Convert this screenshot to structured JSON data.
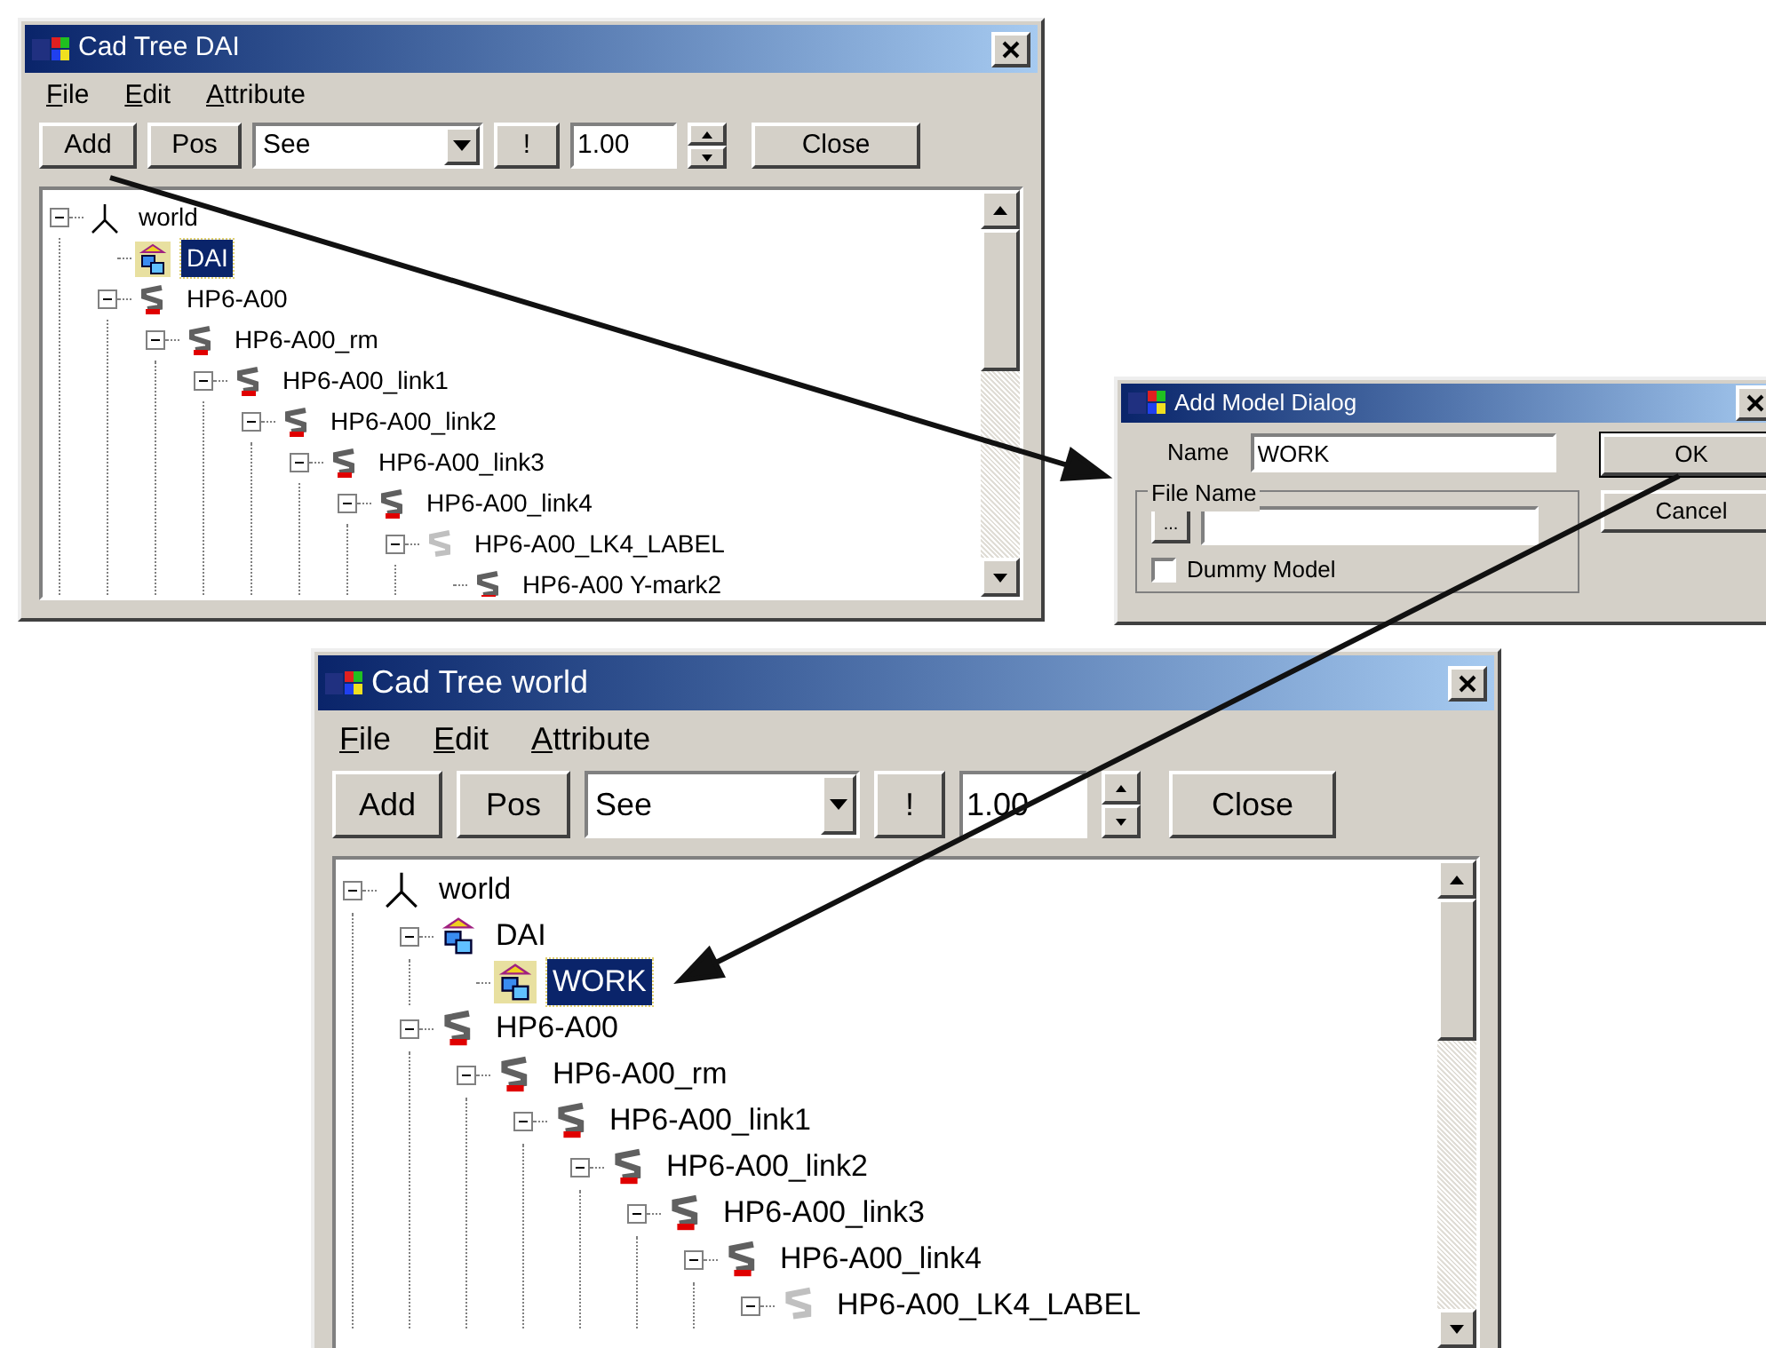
{
  "windows": [
    {
      "title": "Cad Tree DAI",
      "menu": [
        "File",
        "Edit",
        "Attribute"
      ],
      "toolbar": {
        "add": "Add",
        "pos": "Pos",
        "combo": "See",
        "bang": "!",
        "scale": "1.00",
        "close": "Close"
      },
      "tree": [
        {
          "label": "world",
          "kind": "axes",
          "selected": false,
          "expanded": true,
          "children": [
            {
              "label": "DAI",
              "kind": "model",
              "selected": true
            },
            {
              "label": "HP6-A00",
              "kind": "robot",
              "selected": false,
              "expanded": true,
              "children": [
                {
                  "label": "HP6-A00_rm",
                  "kind": "robot",
                  "selected": false,
                  "expanded": true,
                  "children": [
                    {
                      "label": "HP6-A00_link1",
                      "kind": "robot",
                      "selected": false,
                      "expanded": true,
                      "children": [
                        {
                          "label": "HP6-A00_link2",
                          "kind": "robot",
                          "selected": false,
                          "expanded": true,
                          "children": [
                            {
                              "label": "HP6-A00_link3",
                              "kind": "robot",
                              "selected": false,
                              "expanded": true,
                              "children": [
                                {
                                  "label": "HP6-A00_link4",
                                  "kind": "robot",
                                  "selected": false,
                                  "expanded": true,
                                  "children": [
                                    {
                                      "label": "HP6-A00_LK4_LABEL",
                                      "kind": "label",
                                      "selected": false,
                                      "expanded": true,
                                      "children": [
                                        {
                                          "label": "HP6-A00 Y-mark2",
                                          "kind": "robot",
                                          "selected": false
                                        }
                                      ]
                                    }
                                  ]
                                }
                              ]
                            }
                          ]
                        }
                      ]
                    }
                  ]
                }
              ]
            }
          ]
        }
      ]
    },
    {
      "title": "Cad Tree world",
      "menu": [
        "File",
        "Edit",
        "Attribute"
      ],
      "toolbar": {
        "add": "Add",
        "pos": "Pos",
        "combo": "See",
        "bang": "!",
        "scale": "1.00",
        "close": "Close"
      },
      "tree": [
        {
          "label": "world",
          "kind": "axes",
          "selected": false,
          "expanded": true,
          "children": [
            {
              "label": "DAI",
              "kind": "model",
              "selected": false,
              "expanded": true,
              "children": [
                {
                  "label": "WORK",
                  "kind": "model",
                  "selected": true
                }
              ]
            },
            {
              "label": "HP6-A00",
              "kind": "robot",
              "selected": false,
              "expanded": true,
              "children": [
                {
                  "label": "HP6-A00_rm",
                  "kind": "robot",
                  "selected": false,
                  "expanded": true,
                  "children": [
                    {
                      "label": "HP6-A00_link1",
                      "kind": "robot",
                      "selected": false,
                      "expanded": true,
                      "children": [
                        {
                          "label": "HP6-A00_link2",
                          "kind": "robot",
                          "selected": false,
                          "expanded": true,
                          "children": [
                            {
                              "label": "HP6-A00_link3",
                              "kind": "robot",
                              "selected": false,
                              "expanded": true,
                              "children": [
                                {
                                  "label": "HP6-A00_link4",
                                  "kind": "robot",
                                  "selected": false,
                                  "expanded": true,
                                  "children": [
                                    {
                                      "label": "HP6-A00_LK4_LABEL",
                                      "kind": "label",
                                      "selected": false,
                                      "expanded": true
                                    }
                                  ]
                                }
                              ]
                            }
                          ]
                        }
                      ]
                    }
                  ]
                }
              ]
            }
          ]
        }
      ]
    }
  ],
  "dialog": {
    "title": "Add Model Dialog",
    "name_label": "Name",
    "name_value": "WORK",
    "ok": "OK",
    "cancel": "Cancel",
    "file_group": "File Name",
    "browse": "...",
    "dummy_model": {
      "label": "Dummy Model",
      "checked": false
    }
  }
}
